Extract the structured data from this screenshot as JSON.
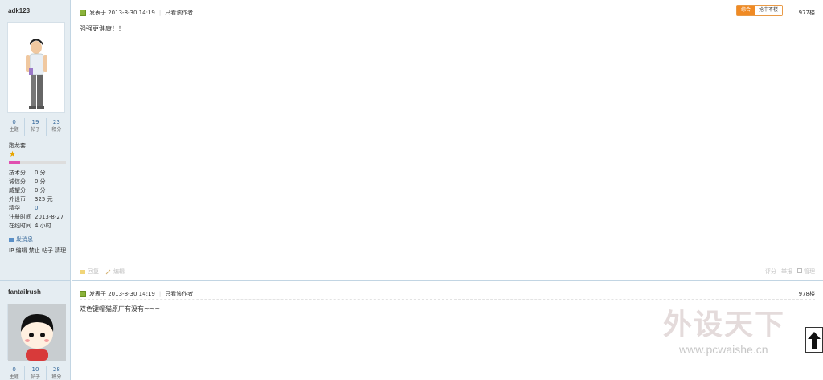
{
  "posts": [
    {
      "username": "adk123",
      "stats": [
        {
          "num": "0",
          "label": "主题"
        },
        {
          "num": "19",
          "label": "帖子"
        },
        {
          "num": "23",
          "label": "积分"
        }
      ],
      "group": "跑龙套",
      "group_progress_fraction": 0.2,
      "info": [
        {
          "k": "技术分",
          "v": "0 分"
        },
        {
          "k": "诚信分",
          "v": "0 分"
        },
        {
          "k": "威望分",
          "v": "0 分"
        },
        {
          "k": "外设币",
          "v": "325 元"
        },
        {
          "k": "精华",
          "v": "0"
        },
        {
          "k": "注册时间",
          "v": "2013-8-27"
        },
        {
          "k": "在线时间",
          "v": "4 小时"
        }
      ],
      "send_message": "发消息",
      "admin_links": "IP 编辑 禁止 帖子 清理",
      "posted": "发表于 2013-8-30 14:19",
      "only_author": "只看该作者",
      "sort_active": "综合",
      "sort_inactive": "抢中不楼",
      "floor": "977楼",
      "content": "强强更健康！！",
      "footer_reply": "回复",
      "footer_edit": "编辑",
      "footer_rate": "评分",
      "footer_report": "举报",
      "footer_manage": "管理"
    },
    {
      "username": "fantailrush",
      "stats": [
        {
          "num": "0",
          "label": "主题"
        },
        {
          "num": "10",
          "label": "帖子"
        },
        {
          "num": "28",
          "label": "积分"
        }
      ],
      "posted": "发表于 2013-8-30 14:19",
      "only_author": "只看该作者",
      "floor": "978楼",
      "content": "双色键帽猫原厂有没有~~~"
    }
  ],
  "watermark": {
    "brand": "外设天下",
    "url": "www.pcwaishe.cn"
  },
  "colors": {
    "sidebar_bg": "#e5edf2",
    "link": "#336699",
    "sort_active": "#f08a24",
    "progress": "#e04fb0"
  }
}
